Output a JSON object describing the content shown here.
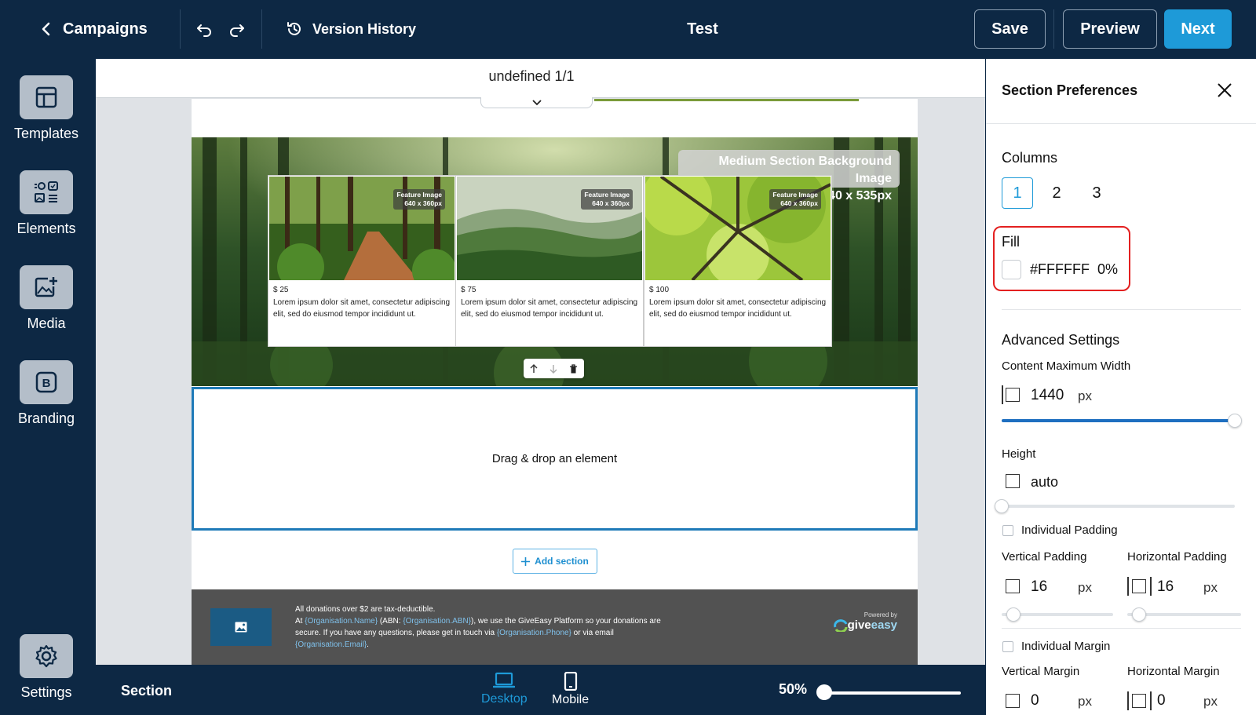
{
  "topbar": {
    "back_label": "Campaigns",
    "version_history_label": "Version History",
    "title": "Test",
    "save_label": "Save",
    "preview_label": "Preview",
    "next_label": "Next"
  },
  "sidebar": {
    "items": [
      {
        "label": "Templates",
        "icon": "layout-icon"
      },
      {
        "label": "Elements",
        "icon": "elements-icon"
      },
      {
        "label": "Media",
        "icon": "add-image-icon"
      },
      {
        "label": "Branding",
        "icon": "branding-icon"
      }
    ],
    "settings_label": "Settings"
  },
  "canvas": {
    "page_indicator": "undefined 1/1",
    "hero": {
      "badge_line1": "Medium Section Background Image",
      "badge_line2": "1440 x 535px",
      "cards": [
        {
          "tag_line1": "Feature Image",
          "tag_line2": "640 x 360px",
          "price": "$ 25",
          "text": "Lorem ipsum dolor sit amet, consectetur adipiscing elit, sed do eiusmod tempor incididunt ut."
        },
        {
          "tag_line1": "Feature Image",
          "tag_line2": "640 x 360px",
          "price": "$ 75",
          "text": "Lorem ipsum dolor sit amet, consectetur adipiscing elit, sed do eiusmod tempor incididunt ut."
        },
        {
          "tag_line1": "Feature Image",
          "tag_line2": "640 x 360px",
          "price": "$ 100",
          "text": "Lorem ipsum dolor sit amet, consectetur adipiscing elit, sed do eiusmod tempor incididunt ut."
        }
      ]
    },
    "dropzone_label": "Drag & drop an element",
    "add_section_label": "Add section",
    "footer": {
      "line1": "All donations over $2 are tax-deductible.",
      "line2_a": "At ",
      "token_org_name": "{Organisation.Name}",
      "line2_b": " (ABN: ",
      "token_org_abn": "{Organisation.ABN}",
      "line2_c": "), we use the GiveEasy Platform so your donations are secure. If you have any questions, please get in touch via ",
      "token_org_phone": "{Organisation.Phone}",
      "line2_d": " or via email ",
      "token_org_email": "{Organisation.Email}",
      "line2_e": ".",
      "powered_by": "Powered by",
      "brand_give": "give",
      "brand_easy": "easy"
    }
  },
  "bottombar": {
    "section_label": "Section",
    "desktop_label": "Desktop",
    "mobile_label": "Mobile",
    "zoom_label": "50%",
    "zoom_value": 50
  },
  "panel": {
    "title": "Section Preferences",
    "columns_label": "Columns",
    "column_options": [
      "1",
      "2",
      "3"
    ],
    "selected_column": "1",
    "fill_label": "Fill",
    "fill_color": "#FFFFFF",
    "fill_opacity": "0%",
    "advanced_label": "Advanced Settings",
    "content_max_width_label": "Content Maximum Width",
    "content_max_width_value": "1440",
    "content_max_width_unit": "px",
    "content_max_width_fraction": 1.0,
    "height_label": "Height",
    "height_value": "auto",
    "individual_padding_label": "Individual Padding",
    "vertical_padding_label": "Vertical Padding",
    "vertical_padding_value": "16",
    "horizontal_padding_label": "Horizontal Padding",
    "horizontal_padding_value": "16",
    "padding_unit": "px",
    "individual_margin_label": "Individual Margin",
    "vertical_margin_label": "Vertical Margin",
    "vertical_margin_value": "0",
    "horizontal_margin_label": "Horizontal Margin",
    "horizontal_margin_value": "0",
    "margin_unit": "px"
  },
  "colors": {
    "navy": "#0d2844",
    "accent": "#1e9ad8",
    "highlight_red": "#e32020"
  }
}
